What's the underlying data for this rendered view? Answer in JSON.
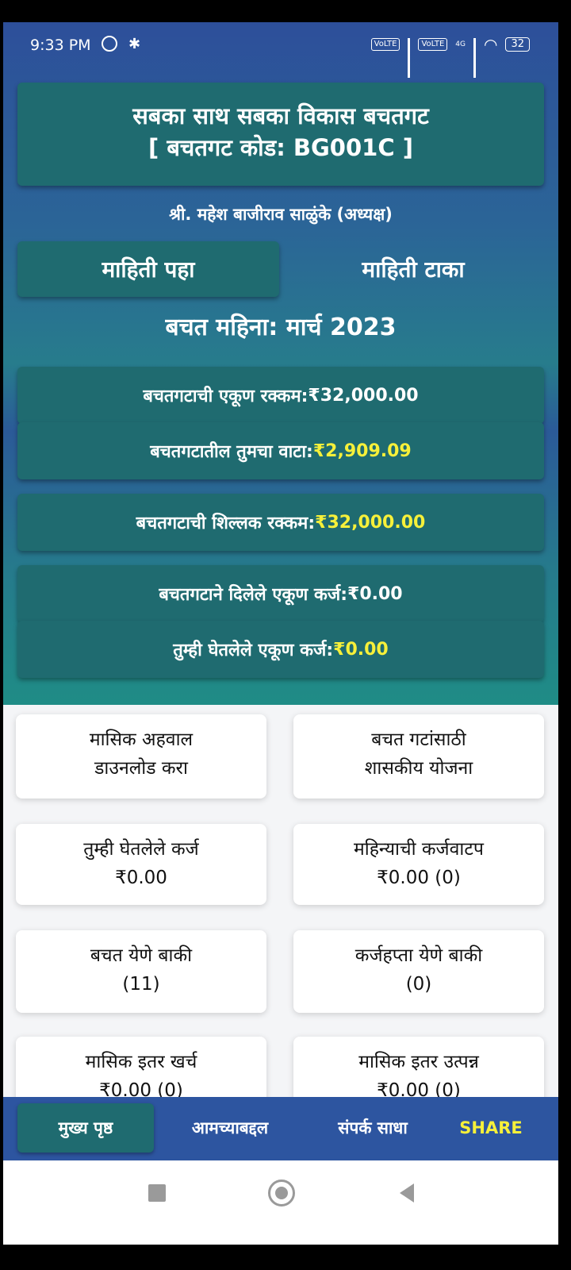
{
  "status_bar": {
    "time": "9:33 PM",
    "battery": "32",
    "volte1": "VoLTE",
    "volte2": "VoLTE",
    "net_type": "4G"
  },
  "header": {
    "group_name": "सबका साथ सबका विकास बचतगट",
    "group_code": "[ बचतगट कोड: BG001C ]",
    "leader": "श्री. महेश बाजीराव साळुंके (अध्यक्ष)"
  },
  "tabs": [
    {
      "label": "माहिती पहा",
      "active": true
    },
    {
      "label": "माहिती टाका",
      "active": false
    }
  ],
  "savings_month": "बचत महिना: मार्च 2023",
  "stats": [
    {
      "label": "बचतगटाची एकूण रक्कम: ",
      "value": "₹32,000.00",
      "highlight": false
    },
    {
      "label": "बचतगटातील तुमचा वाटा: ",
      "value": "₹2,909.09",
      "highlight": true
    },
    {
      "label": "बचतगटाची शिल्लक रक्कम: ",
      "value": "₹32,000.00",
      "highlight": true
    },
    {
      "label": "बचतगटाने दिलेले एकूण कर्ज: ",
      "value": "₹0.00",
      "highlight": false
    },
    {
      "label": "तुम्ही घेतलेले एकूण कर्ज: ",
      "value": "₹0.00",
      "highlight": true
    }
  ],
  "cards": [
    {
      "line1": "मासिक अहवाल",
      "line2": "डाउनलोड करा"
    },
    {
      "line1": "बचत गटांसाठी",
      "line2": "शासकीय योजना"
    },
    {
      "line1": "तुम्ही घेतलेले कर्ज",
      "line2": "₹0.00"
    },
    {
      "line1": "महिन्याची कर्जवाटप",
      "line2": "₹0.00 (0)"
    },
    {
      "line1": "बचत येणे बाकी",
      "line2": "(11)"
    },
    {
      "line1": "कर्जहप्ता येणे बाकी",
      "line2": "(0)"
    },
    {
      "line1": "मासिक इतर खर्च",
      "line2": "₹0.00 (0)"
    },
    {
      "line1": "मासिक इतर उत्पन्न",
      "line2": "₹0.00 (0)"
    }
  ],
  "bottom_nav": [
    {
      "label": "मुख्य पृष्ठ",
      "active": true
    },
    {
      "label": "आमच्याबद्दल",
      "active": false
    },
    {
      "label": "संपर्क साधा",
      "active": false
    },
    {
      "label": "SHARE",
      "active": false
    }
  ],
  "colors": {
    "accent_yellow": "#f6f03a",
    "panel_teal": "#1f6b70",
    "nav_blue": "#2d55a0"
  }
}
